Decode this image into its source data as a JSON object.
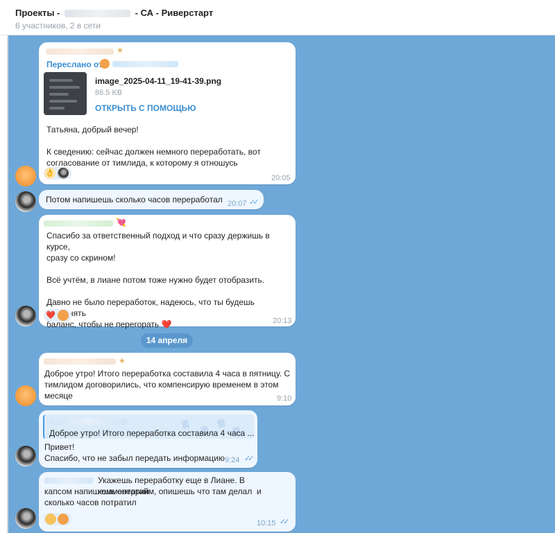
{
  "header": {
    "title_prefix": "Проекты -",
    "title_suffix": "- СА - Риверстарт",
    "subtitle": "6 участников, 2 в сети"
  },
  "date_separator": "14 апреля",
  "messages": [
    {
      "forwarded_label": "Переслано от",
      "file": {
        "name": "image_2025-04-11_19-41-39.png",
        "size": "86.5 KB",
        "action": "ОТКРЫТЬ С ПОМОЩЬЮ"
      },
      "text": "Татьяна, добрый вечер!\n\nК сведению: сейчас должен немного переработать, вот\nсогласование от тимлида, к которому я отношусь",
      "time": "20:05",
      "reaction_emoji": "👌"
    },
    {
      "text": "Потом напишешь сколько часов переработал",
      "time": "20:07"
    },
    {
      "sender_emoji": "💘",
      "text": "Спасибо за ответственный подход и что сразу держишь в курсе,\nсразу со скрином!\n\nВсё учтём, в лиане потом тоже нужно будет отобразить.\n\nДавно не было переработок, надеюсь, что ты будешь сохранять\nбаланс, чтобы не перегорать ❤️",
      "time": "20:13",
      "reaction_emoji": "❤️"
    },
    {
      "text": "Доброе утро! Итого переработка составила 4 часа в пятницу. С\nтимлидом договорились, что компенсирую временем в этом\nмесяце",
      "time": "9:10"
    },
    {
      "reply_quote": "Доброе утро! Итого переработка составила 4 часа ...",
      "text": "Привет!\nСпасибо, что не забыл передать информацию",
      "time": "9:24"
    },
    {
      "text_first_line": "Укажешь переработку еще в Лиане. В комментарии",
      "text_rest": "капсом напишешь овертайм, опишешь что там делал  и\nсколько часов потратил",
      "time": "10:15"
    }
  ]
}
